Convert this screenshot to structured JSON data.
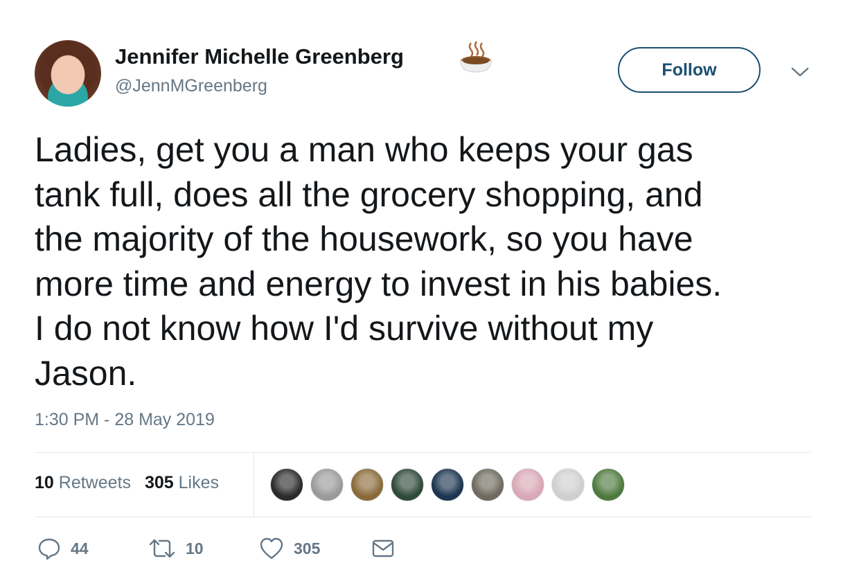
{
  "author": {
    "display_name": "Jennifer Michelle Greenberg",
    "handle": "@JennMGreenberg",
    "name_emoji": "coffee-icon"
  },
  "follow_label": "Follow",
  "tweet": {
    "lines": [
      "Ladies, get you a man who keeps your gas",
      "tank full, does all the grocery shopping, and",
      "the majority of the housework, so you have",
      "more time and energy to invest in his babies.",
      "I do not know how I'd survive without my",
      "Jason."
    ],
    "timestamp": "1:30 PM - 28 May 2019"
  },
  "stats": {
    "retweets_count": "10",
    "retweets_label": "Retweets",
    "likes_count": "305",
    "likes_label": "Likes"
  },
  "likers": [
    {
      "color": "#2b2b2b"
    },
    {
      "color": "#9a9a9a"
    },
    {
      "color": "#8a6a3a"
    },
    {
      "color": "#2f4a3a"
    },
    {
      "color": "#1d3550"
    },
    {
      "color": "#6e6a5e"
    },
    {
      "color": "#d9a7b6"
    },
    {
      "color": "#cfcfcf"
    },
    {
      "color": "#4f7a3e"
    }
  ],
  "actions": {
    "replies": "44",
    "retweets": "10",
    "likes": "305"
  }
}
